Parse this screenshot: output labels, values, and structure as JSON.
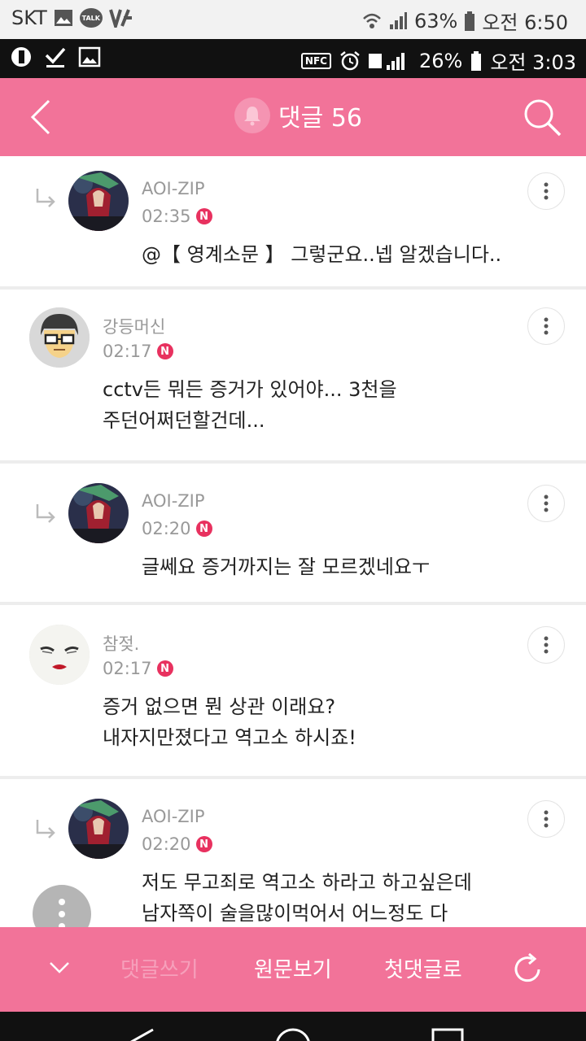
{
  "outer_status": {
    "carrier": "SKT",
    "battery": "63%",
    "time": "오전 6:50",
    "talk_badge": "TALK"
  },
  "inner_status": {
    "battery": "26%",
    "time": "오전 3:03",
    "nfc": "NFC"
  },
  "appbar": {
    "title": "댓글 56"
  },
  "comments": [
    {
      "author": "AOI-ZIP",
      "time": "02:35",
      "is_reply": true,
      "lines": [
        "@【 영계소문 】 그렇군요..넵 알겠습니다.."
      ]
    },
    {
      "author": "강등머신",
      "time": "02:17",
      "is_reply": false,
      "lines": [
        "cctv든 뭐든 증거가 있어야... 3천을",
        "주던어쩌던할건데..."
      ]
    },
    {
      "author": "AOI-ZIP",
      "time": "02:20",
      "is_reply": true,
      "lines": [
        "글쎄요 증거까지는 잘 모르겠네요ㅜ"
      ]
    },
    {
      "author": "참젖.",
      "time": "02:17",
      "is_reply": false,
      "lines": [
        "증거 없으면 뭔 상관 이래요?",
        "내자지만졌다고 역고소 하시죠!"
      ]
    },
    {
      "author": "AOI-ZIP",
      "time": "02:20",
      "is_reply": true,
      "lines": [
        "저도 무고죄로 역고소 하라고 하고싶은데",
        "남자쪽이 술을많이먹어서 어느정도 다"
      ]
    }
  ],
  "new_badge": "N",
  "bottombar": {
    "write": "댓글쓰기",
    "original": "원문보기",
    "first": "첫댓글로"
  },
  "colors": {
    "accent": "#f27399",
    "badge": "#e8315f"
  }
}
